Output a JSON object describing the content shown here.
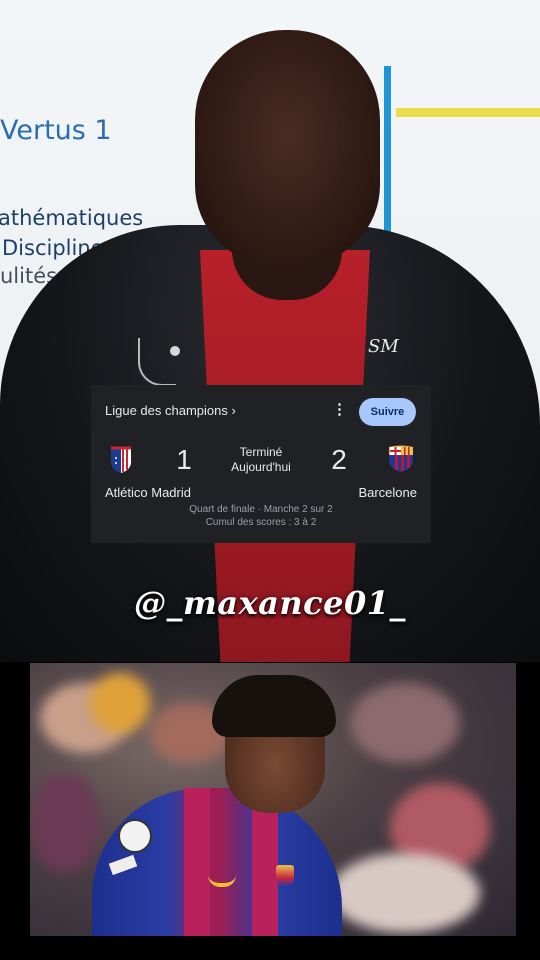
{
  "background": {
    "board_title": "Vertus 1",
    "board_lines": [
      "athématiques",
      "Discipline",
      "ulités"
    ],
    "pin_logo": "SM"
  },
  "score_card": {
    "league_link": "Ligue des champions ›",
    "more_icon": "⋮",
    "follow_label": "Suivre",
    "home_team": {
      "name": "Atlético Madrid",
      "score": "1",
      "crest_icon": "atletico-madrid-crest-icon"
    },
    "away_team": {
      "name": "Barcelone",
      "score": "2",
      "crest_icon": "fc-barcelona-crest-icon"
    },
    "status": "Terminé",
    "date": "Aujourd'hui",
    "round": "Quart de finale · Manche 2 sur 2",
    "aggregate": "Cumul des scores : 3 à 2",
    "colors": {
      "card_bg": "#202124",
      "follow_bg": "#a8c7fa",
      "follow_text": "#062e6f"
    }
  },
  "watermark": {
    "handle": "@_maxance01_"
  }
}
